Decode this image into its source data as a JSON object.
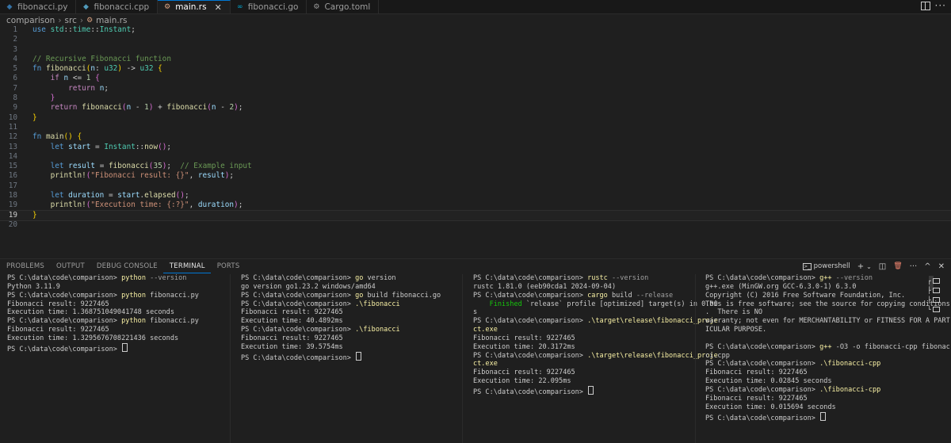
{
  "tabs": [
    {
      "label": "fibonacci.py",
      "icon": "python-file-icon",
      "icon_glyph": "◆",
      "icon_color": "#3572a5",
      "active": false
    },
    {
      "label": "fibonacci.cpp",
      "icon": "cpp-file-icon",
      "icon_glyph": "◆",
      "icon_color": "#519aba",
      "active": false
    },
    {
      "label": "main.rs",
      "icon": "rust-file-icon",
      "icon_glyph": "⚙",
      "icon_color": "#dea584",
      "active": true,
      "close": "✕"
    },
    {
      "label": "fibonacci.go",
      "icon": "go-file-icon",
      "icon_glyph": "∞",
      "icon_color": "#00add8",
      "active": false
    },
    {
      "label": "Cargo.toml",
      "icon": "toml-file-icon",
      "icon_glyph": "⚙",
      "icon_color": "#9d9d9d",
      "active": false
    }
  ],
  "breadcrumb": {
    "folder1": "comparison",
    "folder2": "src",
    "file": "main.rs",
    "sep": "›",
    "file_icon_glyph": "⚙"
  },
  "editor": {
    "line_numbers": [
      "1",
      "2",
      "3",
      "4",
      "5",
      "6",
      "7",
      "8",
      "9",
      "10",
      "11",
      "12",
      "13",
      "14",
      "15",
      "16",
      "17",
      "18",
      "19",
      "20"
    ],
    "current_line": 19
  },
  "panel": {
    "tabs": [
      "PROBLEMS",
      "OUTPUT",
      "DEBUG CONSOLE",
      "TERMINAL",
      "PORTS"
    ],
    "active_tab": "TERMINAL",
    "shell_label": "powershell",
    "add_glyph": "+",
    "chevron_glyph": "⌄",
    "split_glyph": "◫",
    "trash_glyph": "🗑",
    "more_glyph": "···",
    "up_glyph": "^",
    "close_glyph": "✕"
  },
  "terminal_list": [
    "┌",
    "├",
    "├",
    "└"
  ],
  "terminals": [
    {
      "name": "terminal-python",
      "lines": [
        [
          [
            "PS C:\\data\\code\\comparison> ",
            ""
          ],
          [
            "python",
            "cmd"
          ],
          [
            " --version",
            "arg"
          ]
        ],
        [
          [
            "Python 3.11.9",
            ""
          ]
        ],
        [
          [
            "PS C:\\data\\code\\comparison> ",
            ""
          ],
          [
            "python",
            "cmd"
          ],
          [
            " fibonacci.py",
            ""
          ]
        ],
        [
          [
            "Fibonacci result: 9227465",
            ""
          ]
        ],
        [
          [
            "Execution time: 1.368751049041748 seconds",
            ""
          ]
        ],
        [
          [
            "PS C:\\data\\code\\comparison> ",
            ""
          ],
          [
            "python",
            "cmd"
          ],
          [
            " fibonacci.py",
            ""
          ]
        ],
        [
          [
            "Fibonacci result: 9227465",
            ""
          ]
        ],
        [
          [
            "Execution time: 1.3295676708221436 seconds",
            ""
          ]
        ],
        [
          [
            "PS C:\\data\\code\\comparison> ",
            ""
          ],
          [
            "",
            "cursor"
          ]
        ]
      ]
    },
    {
      "name": "terminal-go",
      "lines": [
        [
          [
            "PS C:\\data\\code\\comparison> ",
            ""
          ],
          [
            "go",
            "cmd"
          ],
          [
            " version",
            ""
          ]
        ],
        [
          [
            "go version go1.23.2 windows/amd64",
            ""
          ]
        ],
        [
          [
            "PS C:\\data\\code\\comparison> ",
            ""
          ],
          [
            "go",
            "cmd"
          ],
          [
            " build fibonacci.go",
            ""
          ]
        ],
        [
          [
            "PS C:\\data\\code\\comparison> ",
            ""
          ],
          [
            ".\\fibonacci",
            "cmd"
          ]
        ],
        [
          [
            "Fibonacci result: 9227465",
            ""
          ]
        ],
        [
          [
            "Execution time: 40.4892ms",
            ""
          ]
        ],
        [
          [
            "PS C:\\data\\code\\comparison> ",
            ""
          ],
          [
            ".\\fibonacci",
            "cmd"
          ]
        ],
        [
          [
            "Fibonacci result: 9227465",
            ""
          ]
        ],
        [
          [
            "Execution time: 39.5754ms",
            ""
          ]
        ],
        [
          [
            "PS C:\\data\\code\\comparison> ",
            ""
          ],
          [
            "",
            "cursor"
          ]
        ]
      ]
    },
    {
      "name": "terminal-rust",
      "lines": [
        [
          [
            "PS C:\\data\\code\\comparison> ",
            ""
          ],
          [
            "rustc",
            "cmd"
          ],
          [
            " --version",
            "arg"
          ]
        ],
        [
          [
            "rustc 1.81.0 (eeb90cda1 2024-09-04)",
            ""
          ]
        ],
        [
          [
            "PS C:\\data\\code\\comparison> ",
            ""
          ],
          [
            "cargo",
            "cmd"
          ],
          [
            " build ",
            ""
          ],
          [
            "--release",
            "arg"
          ]
        ],
        [
          [
            "    Finished",
            "grn"
          ],
          [
            " `release` profile [optimized] target(s) in 0.00",
            ""
          ]
        ],
        [
          [
            "s",
            ""
          ]
        ],
        [
          [
            "PS C:\\data\\code\\comparison> ",
            ""
          ],
          [
            ".\\target\\release\\fibonacci_proje",
            "cmd"
          ]
        ],
        [
          [
            "ct.exe",
            "cmd"
          ]
        ],
        [
          [
            "Fibonacci result: 9227465",
            ""
          ]
        ],
        [
          [
            "Execution time: 20.3172ms",
            ""
          ]
        ],
        [
          [
            "PS C:\\data\\code\\comparison> ",
            ""
          ],
          [
            ".\\target\\release\\fibonacci_proje",
            "cmd"
          ]
        ],
        [
          [
            "ct.exe",
            "cmd"
          ]
        ],
        [
          [
            "Fibonacci result: 9227465",
            ""
          ]
        ],
        [
          [
            "Execution time: 22.095ms",
            ""
          ]
        ],
        [
          [
            "PS C:\\data\\code\\comparison> ",
            ""
          ],
          [
            "",
            "cursor"
          ]
        ]
      ]
    },
    {
      "name": "terminal-cpp",
      "lines": [
        [
          [
            "PS C:\\data\\code\\comparison> ",
            ""
          ],
          [
            "g++",
            "cmd"
          ],
          [
            " --version",
            "arg"
          ]
        ],
        [
          [
            "g++.exe (MinGW.org GCC-6.3.0-1) 6.3.0",
            ""
          ]
        ],
        [
          [
            "Copyright (C) 2016 Free Software Foundation, Inc.",
            ""
          ]
        ],
        [
          [
            "This is free software; see the source for copying conditions",
            ""
          ]
        ],
        [
          [
            ".  There is NO",
            ""
          ]
        ],
        [
          [
            "warranty; not even for MERCHANTABILITY or FITNESS FOR A PART",
            ""
          ]
        ],
        [
          [
            "ICULAR PURPOSE.",
            ""
          ]
        ],
        [
          [
            "",
            ""
          ]
        ],
        [
          [
            "PS C:\\data\\code\\comparison> ",
            ""
          ],
          [
            "g++",
            "cmd"
          ],
          [
            " -O3 -o fibonacci-cpp fibonac",
            ""
          ]
        ],
        [
          [
            "ci.cpp",
            ""
          ]
        ],
        [
          [
            "PS C:\\data\\code\\comparison> ",
            ""
          ],
          [
            ".\\fibonacci-cpp",
            "cmd"
          ]
        ],
        [
          [
            "Fibonacci result: 9227465",
            ""
          ]
        ],
        [
          [
            "Execution time: 0.02845 seconds",
            ""
          ]
        ],
        [
          [
            "PS C:\\data\\code\\comparison> ",
            ""
          ],
          [
            ".\\fibonacci-cpp",
            "cmd"
          ]
        ],
        [
          [
            "Fibonacci result: 9227465",
            ""
          ]
        ],
        [
          [
            "Execution time: 0.015694 seconds",
            ""
          ]
        ],
        [
          [
            "PS C:\\data\\code\\comparison> ",
            ""
          ],
          [
            "",
            "cursor"
          ]
        ]
      ]
    }
  ]
}
